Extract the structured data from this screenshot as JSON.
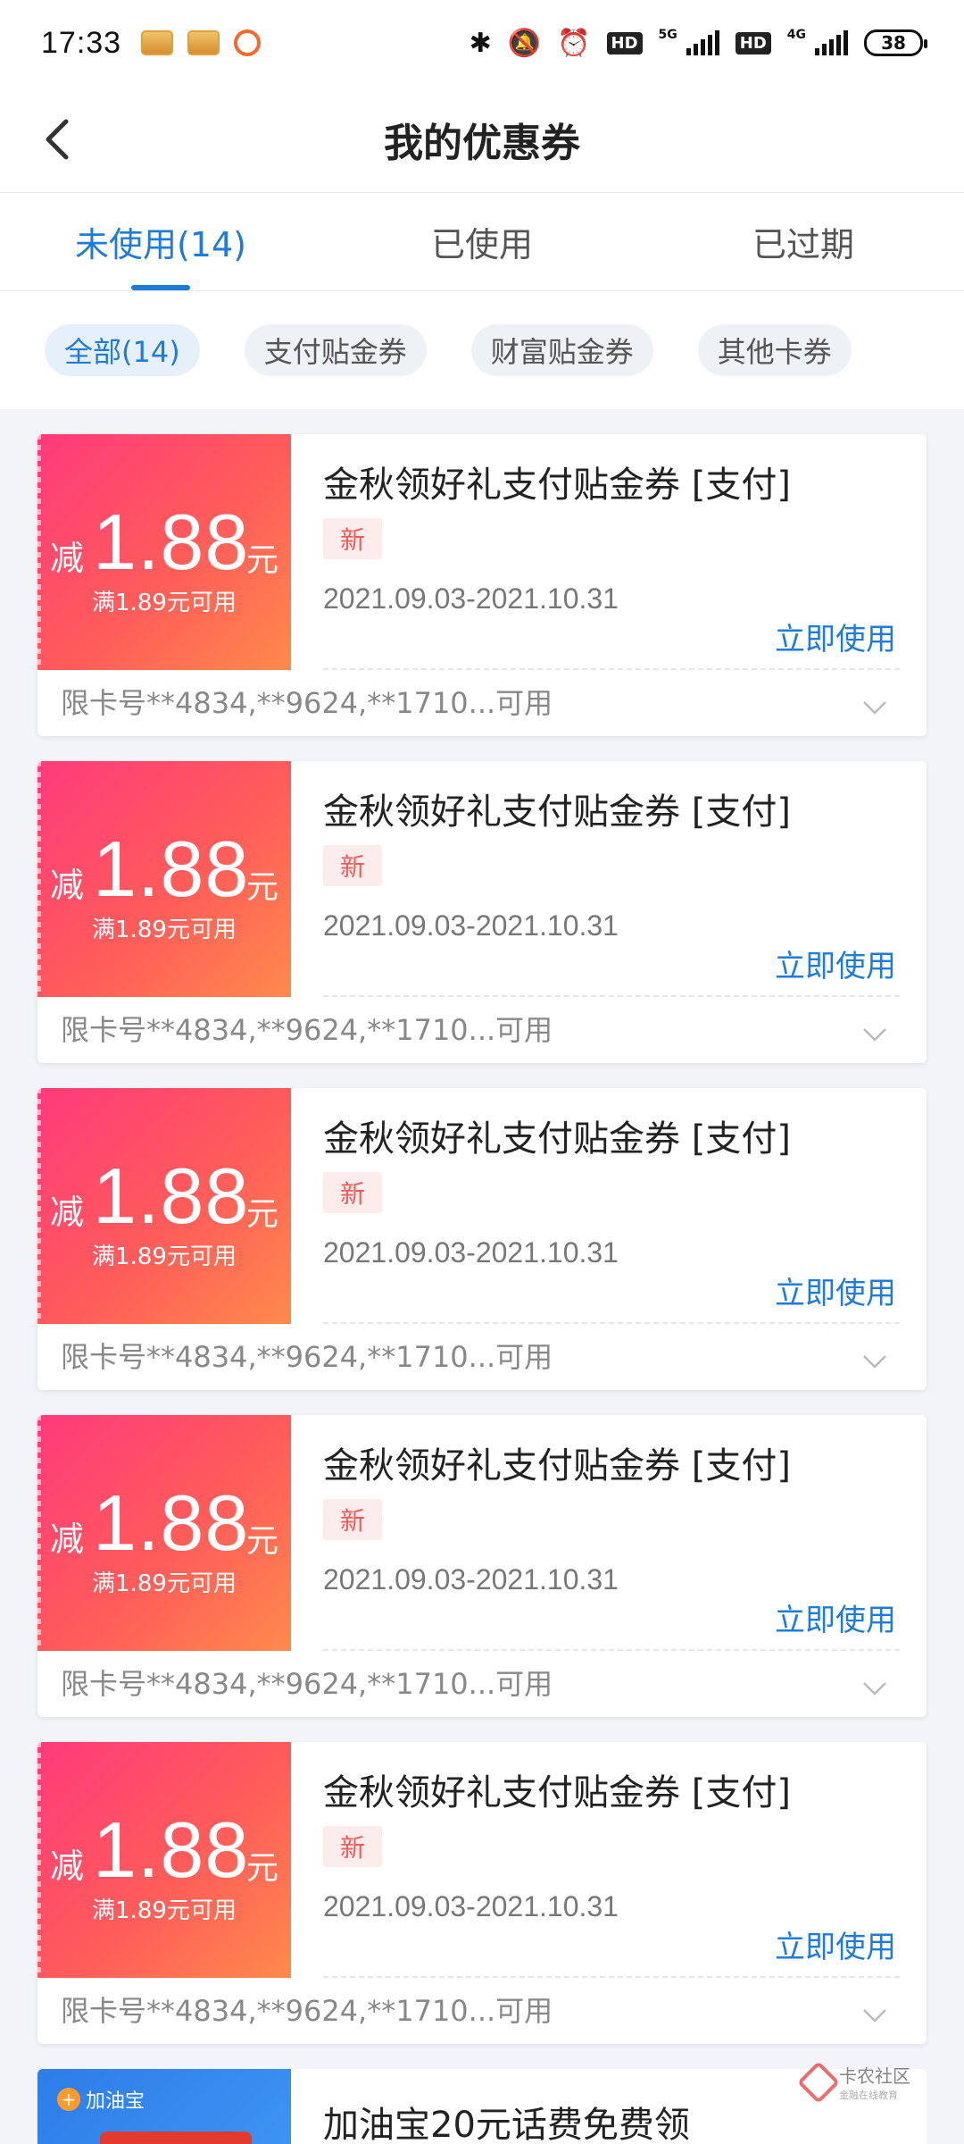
{
  "status_bar": {
    "time": "17:33",
    "net_label_1": "5G",
    "net_label_2": "4G",
    "hd": "HD",
    "battery": "38"
  },
  "header": {
    "title": "我的优惠券"
  },
  "tabs": [
    {
      "label": "未使用(14)"
    },
    {
      "label": "已使用"
    },
    {
      "label": "已过期"
    }
  ],
  "filters": [
    {
      "label": "全部(14)"
    },
    {
      "label": "支付贴金券"
    },
    {
      "label": "财富贴金券"
    },
    {
      "label": "其他卡券"
    }
  ],
  "coupons": [
    {
      "prefix": "减",
      "amount": "1.88",
      "unit": "元",
      "condition": "满1.89元可用",
      "title": "金秋领好礼支付贴金券  [支付]",
      "badge": "新",
      "date": "2021.09.03-2021.10.31",
      "action": "立即使用",
      "limit": "限卡号**4834,**9624,**1710...可用"
    },
    {
      "prefix": "减",
      "amount": "1.88",
      "unit": "元",
      "condition": "满1.89元可用",
      "title": "金秋领好礼支付贴金券  [支付]",
      "badge": "新",
      "date": "2021.09.03-2021.10.31",
      "action": "立即使用",
      "limit": "限卡号**4834,**9624,**1710...可用"
    },
    {
      "prefix": "减",
      "amount": "1.88",
      "unit": "元",
      "condition": "满1.89元可用",
      "title": "金秋领好礼支付贴金券  [支付]",
      "badge": "新",
      "date": "2021.09.03-2021.10.31",
      "action": "立即使用",
      "limit": "限卡号**4834,**9624,**1710...可用"
    },
    {
      "prefix": "减",
      "amount": "1.88",
      "unit": "元",
      "condition": "满1.89元可用",
      "title": "金秋领好礼支付贴金券  [支付]",
      "badge": "新",
      "date": "2021.09.03-2021.10.31",
      "action": "立即使用",
      "limit": "限卡号**4834,**9624,**1710...可用"
    },
    {
      "prefix": "减",
      "amount": "1.88",
      "unit": "元",
      "condition": "满1.89元可用",
      "title": "金秋领好礼支付贴金券  [支付]",
      "badge": "新",
      "date": "2021.09.03-2021.10.31",
      "action": "立即使用",
      "limit": "限卡号**4834,**9624,**1710...可用"
    }
  ],
  "promo": {
    "logo_text": "加油宝",
    "title": "加油宝20元话费免费领"
  },
  "watermark": {
    "main": "卡农社区",
    "sub": "金融在线教育"
  },
  "colors": {
    "accent": "#1f7bd8",
    "coupon_gradient_start": "#ff3a7c",
    "coupon_gradient_end": "#ff8a4c",
    "badge_text": "#f05a5a"
  }
}
